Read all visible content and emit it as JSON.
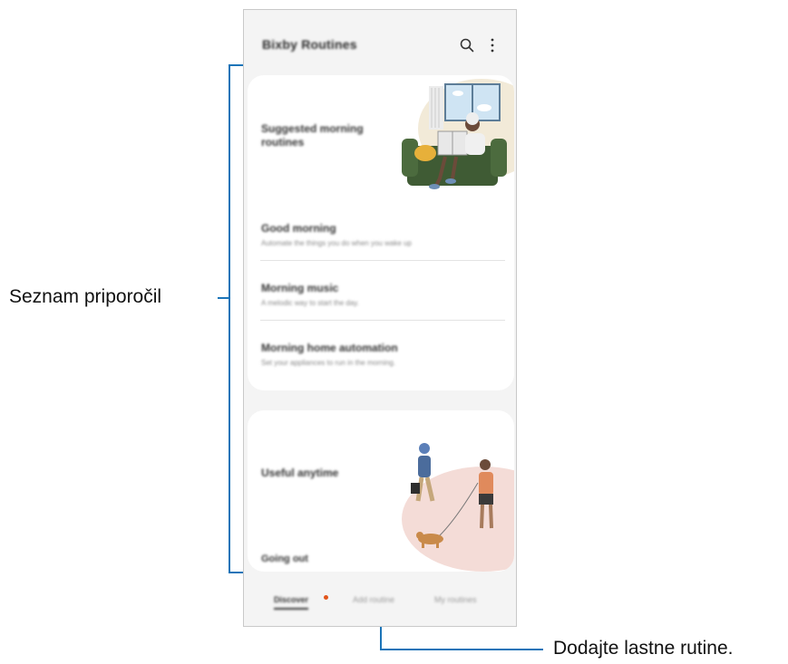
{
  "app": {
    "title": "Bixby Routines",
    "search_icon": "search-icon",
    "more_icon": "more-vertical-icon"
  },
  "suggested": {
    "title": "Suggested morning routines",
    "items": [
      {
        "title": "Good morning",
        "subtitle": "Automate the things you do when you wake up"
      },
      {
        "title": "Morning music",
        "subtitle": "A melodic way to start the day."
      },
      {
        "title": "Morning home automation",
        "subtitle": "Set your appliances to run in the morning."
      }
    ]
  },
  "useful": {
    "title": "Useful anytime",
    "next_item": "Going out"
  },
  "tabs": {
    "discover": "Discover",
    "add_routine": "Add routine",
    "my_routines": "My routines"
  },
  "annotations": {
    "recommendations_label": "Seznam priporočil",
    "add_routines_label": "Dodajte lastne rutine."
  },
  "colors": {
    "accent_line": "#1b74b8",
    "badge": "#e2551b"
  }
}
